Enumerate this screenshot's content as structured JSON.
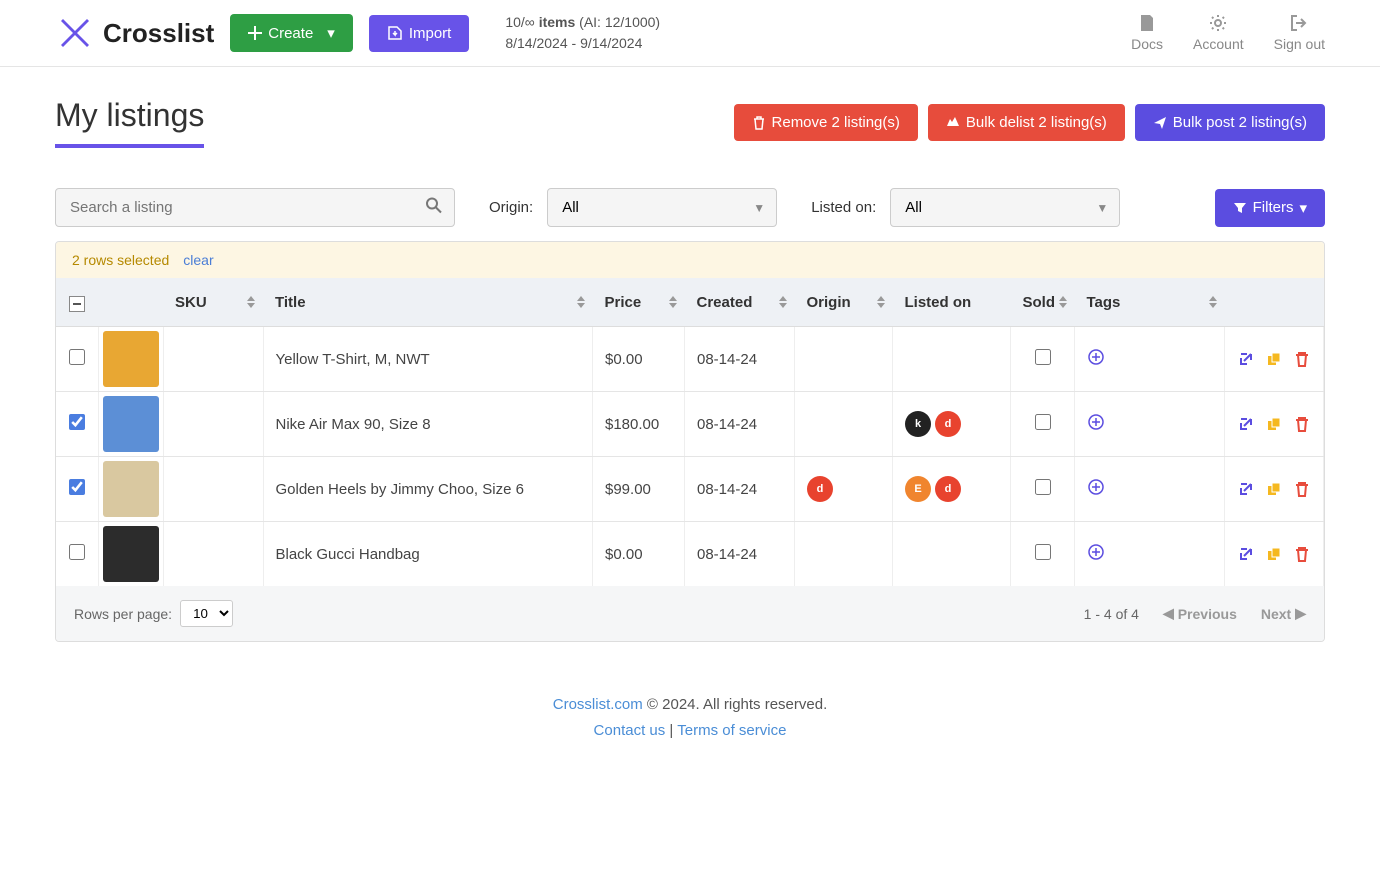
{
  "brand": "Crosslist",
  "header": {
    "create_label": "Create",
    "import_label": "Import",
    "info_line1_prefix": "10/∞ ",
    "info_line1_items": "items",
    "info_line1_ai": " (AI: 12/1000)",
    "info_line2": "8/14/2024 - 9/14/2024",
    "nav": {
      "docs": "Docs",
      "account": "Account",
      "signout": "Sign out"
    }
  },
  "page": {
    "title": "My listings",
    "remove": "Remove 2 listing(s)",
    "delist": "Bulk delist 2 listing(s)",
    "post": "Bulk post 2 listing(s)"
  },
  "filters": {
    "search_placeholder": "Search a listing",
    "origin_label": "Origin:",
    "origin_value": "All",
    "listed_label": "Listed on:",
    "listed_value": "All",
    "filters_btn": "Filters"
  },
  "selection": {
    "text": "2 rows selected",
    "clear": "clear"
  },
  "columns": {
    "sku": "SKU",
    "title": "Title",
    "price": "Price",
    "created": "Created",
    "origin": "Origin",
    "listed": "Listed on",
    "sold": "Sold",
    "tags": "Tags"
  },
  "rows": [
    {
      "checked": false,
      "thumb_bg": "#e8a733",
      "title": "Yellow T-Shirt, M, NWT",
      "price": "$0.00",
      "created": "08-14-24",
      "origin": [],
      "listed": []
    },
    {
      "checked": true,
      "thumb_bg": "#5c8fd6",
      "title": "Nike Air Max 90, Size 8",
      "price": "$180.00",
      "created": "08-14-24",
      "origin": [],
      "listed": [
        "k",
        "d"
      ]
    },
    {
      "checked": true,
      "thumb_bg": "#d9c8a0",
      "title": "Golden Heels by Jimmy Choo, Size 6",
      "price": "$99.00",
      "created": "08-14-24",
      "origin": [
        "d"
      ],
      "listed": [
        "e",
        "d"
      ]
    },
    {
      "checked": false,
      "thumb_bg": "#2c2c2c",
      "title": "Black Gucci Handbag",
      "price": "$0.00",
      "created": "08-14-24",
      "origin": [],
      "listed": []
    }
  ],
  "tablefooter": {
    "rows_label": "Rows per page:",
    "rows_value": "10",
    "range": "1 - 4 of 4",
    "prev": "Previous",
    "next": "Next"
  },
  "footer": {
    "site": "Crosslist.com",
    "copyright": " © 2024. All rights reserved.",
    "contact": "Contact us",
    "sep": " | ",
    "tos": "Terms of service"
  }
}
